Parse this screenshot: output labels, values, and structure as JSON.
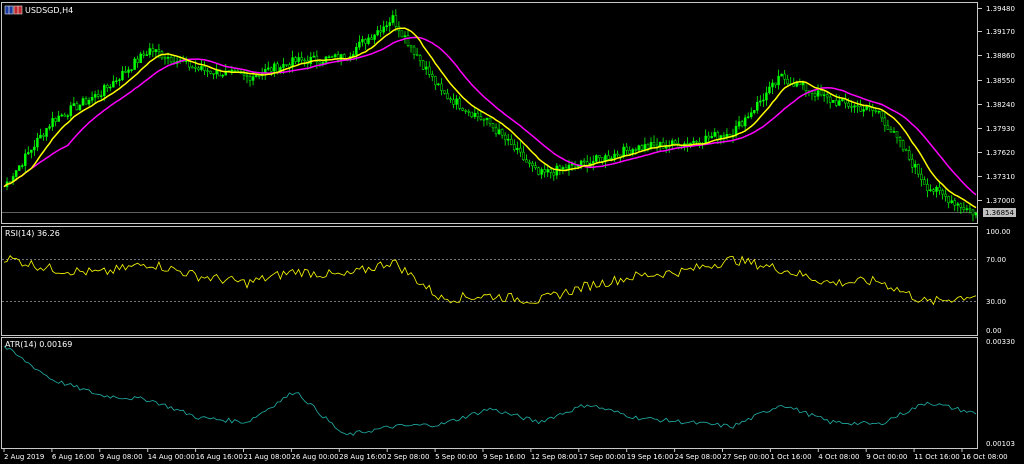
{
  "window": {
    "symbol_title": "USDSGD,H4",
    "icon": "chart-window-icon"
  },
  "price_panel": {
    "price_ticks": [
      "1.39480",
      "1.39170",
      "1.38860",
      "1.38550",
      "1.38240",
      "1.37930",
      "1.37620",
      "1.37310",
      "1.37000"
    ],
    "current_price": "1.36854",
    "colors": {
      "candle": "#00ff00",
      "ma_fast": "#ffff00",
      "ma_slow": "#ff00ff",
      "background": "#000000",
      "current_price_box": "#c0c0c0"
    }
  },
  "rsi_panel": {
    "label": "RSI(14) 36.26",
    "ticks": [
      "100.00",
      "70.00",
      "30.00",
      "0.00"
    ],
    "levels": [
      70,
      30
    ],
    "color": "#ffff00"
  },
  "atr_panel": {
    "label": "ATR(14) 0.00169",
    "ticks": [
      "0.00330",
      "0.00103"
    ],
    "color": "#20b2aa"
  },
  "time_axis": [
    "2 Aug 2019",
    "6 Aug 16:00",
    "9 Aug 08:00",
    "14 Aug 00:00",
    "16 Aug 16:00",
    "21 Aug 08:00",
    "26 Aug 00:00",
    "28 Aug 16:00",
    "2 Sep 08:00",
    "5 Sep 00:00",
    "9 Sep 16:00",
    "12 Sep 08:00",
    "17 Sep 00:00",
    "19 Sep 16:00",
    "24 Sep 08:00",
    "27 Sep 00:00",
    "1 Oct 16:00",
    "4 Oct 08:00",
    "9 Oct 00:00",
    "11 Oct 16:00",
    "16 Oct 08:00"
  ],
  "chart_data": {
    "type": "line",
    "x": [
      "2 Aug 2019",
      "6 Aug 16:00",
      "9 Aug 08:00",
      "14 Aug 00:00",
      "16 Aug 16:00",
      "21 Aug 08:00",
      "26 Aug 00:00",
      "28 Aug 16:00",
      "2 Sep 08:00",
      "5 Sep 00:00",
      "9 Sep 16:00",
      "12 Sep 08:00",
      "17 Sep 00:00",
      "19 Sep 16:00",
      "24 Sep 08:00",
      "27 Sep 00:00",
      "1 Oct 16:00",
      "4 Oct 08:00",
      "9 Oct 00:00",
      "11 Oct 16:00",
      "16 Oct 08:00"
    ],
    "price_close": [
      1.372,
      1.3805,
      1.384,
      1.3895,
      1.387,
      1.386,
      1.388,
      1.3885,
      1.3935,
      1.384,
      1.38,
      1.3735,
      1.375,
      1.377,
      1.3775,
      1.379,
      1.386,
      1.383,
      1.3815,
      1.372,
      1.3685
    ],
    "rsi_values": [
      74,
      62,
      58,
      68,
      55,
      48,
      60,
      55,
      70,
      32,
      35,
      30,
      45,
      55,
      60,
      72,
      62,
      48,
      50,
      28,
      36
    ],
    "atr_values": [
      0.0032,
      0.00245,
      0.0021,
      0.002,
      0.0016,
      0.0015,
      0.0022,
      0.0012,
      0.0014,
      0.00145,
      0.0018,
      0.0015,
      0.0019,
      0.0016,
      0.0015,
      0.0014,
      0.0019,
      0.0015,
      0.00145,
      0.00195,
      0.00169
    ],
    "ylim_price": [
      1.3685,
      1.3948
    ],
    "ylim_rsi": [
      0,
      100
    ],
    "ylim_atr": [
      0.00103,
      0.0033
    ],
    "grid": false
  }
}
